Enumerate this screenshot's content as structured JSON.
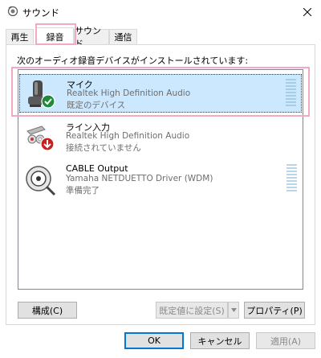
{
  "window": {
    "title": "サウンド",
    "app_icon": "speaker-icon",
    "close_icon": "close-icon"
  },
  "tabs": [
    {
      "label": "再生"
    },
    {
      "label": "録音"
    },
    {
      "label": "サウンド"
    },
    {
      "label": "通信"
    }
  ],
  "active_tab": "録音",
  "instruction": "次のオーディオ録音デバイスがインストールされています:",
  "devices": [
    {
      "name": "マイク",
      "driver": "Realtek High Definition Audio",
      "status": "既定のデバイス",
      "icon": "microphone-icon",
      "badge": "check-badge-icon"
    },
    {
      "name": "ライン入力",
      "driver": "Realtek High Definition Audio",
      "status": "接続されていません",
      "icon": "line-in-jack-icon",
      "badge": "down-arrow-badge-icon"
    },
    {
      "name": "CABLE Output",
      "driver": "Yamaha NETDUETTO Driver (WDM)",
      "status": "準備完了",
      "icon": "cable-reel-icon"
    }
  ],
  "buttons": {
    "configure": "構成(C)",
    "set_default": "既定値に設定(S)",
    "properties": "プロパティ(P)",
    "ok": "OK",
    "cancel": "キャンセル",
    "apply": "適用(A)"
  },
  "colors": {
    "selection": "#cce8ff",
    "highlight": "#f4a8c8",
    "accent": "#0078d7"
  }
}
